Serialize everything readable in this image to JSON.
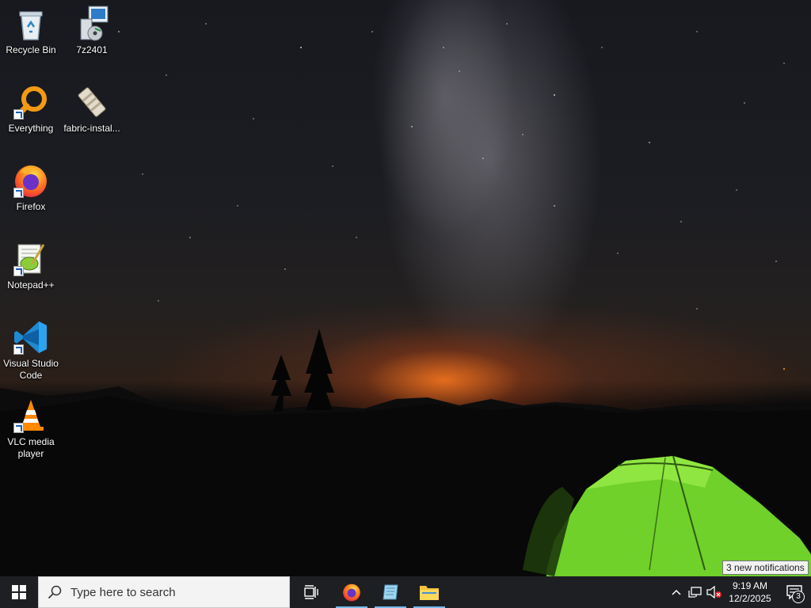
{
  "desktop_icons": [
    {
      "label": "Recycle Bin",
      "icon": "recycle-bin-icon"
    },
    {
      "label": "7z2401",
      "icon": "installer-icon"
    },
    {
      "label": "Everything",
      "icon": "everything-search-icon"
    },
    {
      "label": "fabric-instal...",
      "icon": "jar-file-icon"
    },
    {
      "label": "Firefox",
      "icon": "firefox-icon"
    },
    {
      "label": "Notepad++",
      "icon": "notepad-plus-plus-icon"
    },
    {
      "label": "Visual Studio Code",
      "icon": "vscode-icon"
    },
    {
      "label": "VLC media player",
      "icon": "vlc-icon"
    }
  ],
  "taskbar": {
    "search_placeholder": "Type here to search",
    "pinned": [
      "task-view",
      "firefox",
      "notepad-app",
      "file-explorer"
    ],
    "clock_time": "9:19 AM",
    "clock_date": "12/2/2025",
    "notification_count": "3",
    "tooltip": "3 new notifications"
  },
  "colors": {
    "taskbar_bg": "#1e1f22",
    "accent": "#76b9ed"
  }
}
